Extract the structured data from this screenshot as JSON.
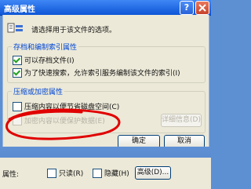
{
  "window": {
    "title": "高级属性",
    "help_label": "?"
  },
  "dialog": {
    "instruction": "请选择用于该文件的选项。",
    "archive_index_group": {
      "title": "存档和编制索引属性",
      "archive_option": {
        "label": "可以存档文件(I)",
        "checked": true
      },
      "index_option": {
        "label": "为了快速搜索，允许索引服务编制该文件的索引(I)",
        "checked": true
      }
    },
    "compress_encrypt_group": {
      "title": "压缩或加密属性",
      "compress_option": {
        "label": "压缩内容以便节省磁盘空间(C)",
        "checked": false
      },
      "encrypt_option": {
        "label": "加密内容以便保护数据(E)",
        "checked": false,
        "enabled": false
      },
      "details_button": "详细信息(D)"
    },
    "ok_button": "确定",
    "cancel_button": "取消"
  },
  "properties_panel": {
    "attributes_label": "属性:",
    "readonly_option": {
      "label": "只读(R)",
      "checked": false
    },
    "hidden_option": {
      "label": "隐藏(H)",
      "checked": false
    },
    "advanced_button": "高级(D)..."
  },
  "colors": {
    "titlebar": "#0d55d6",
    "dialog_bg": "#ece9d8",
    "group_title": "#0046d5",
    "annotation_red": "#e00000"
  }
}
